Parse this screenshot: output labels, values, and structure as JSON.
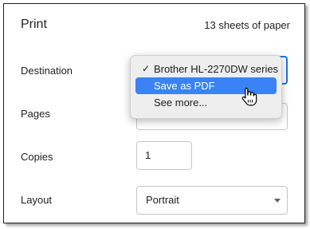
{
  "dialog": {
    "title": "Print",
    "sheets": "13 sheets of paper"
  },
  "destination": {
    "label": "Destination",
    "options": [
      {
        "label": "Brother HL-2270DW series",
        "checked": true
      },
      {
        "label": "Save as PDF",
        "highlighted": true
      },
      {
        "label": "See more..."
      }
    ]
  },
  "pages": {
    "label": "Pages"
  },
  "copies": {
    "label": "Copies",
    "value": "1"
  },
  "layout": {
    "label": "Layout",
    "value": "Portrait"
  },
  "colors": {
    "accent": "#1a73e8",
    "highlight": "#3b82f6"
  }
}
